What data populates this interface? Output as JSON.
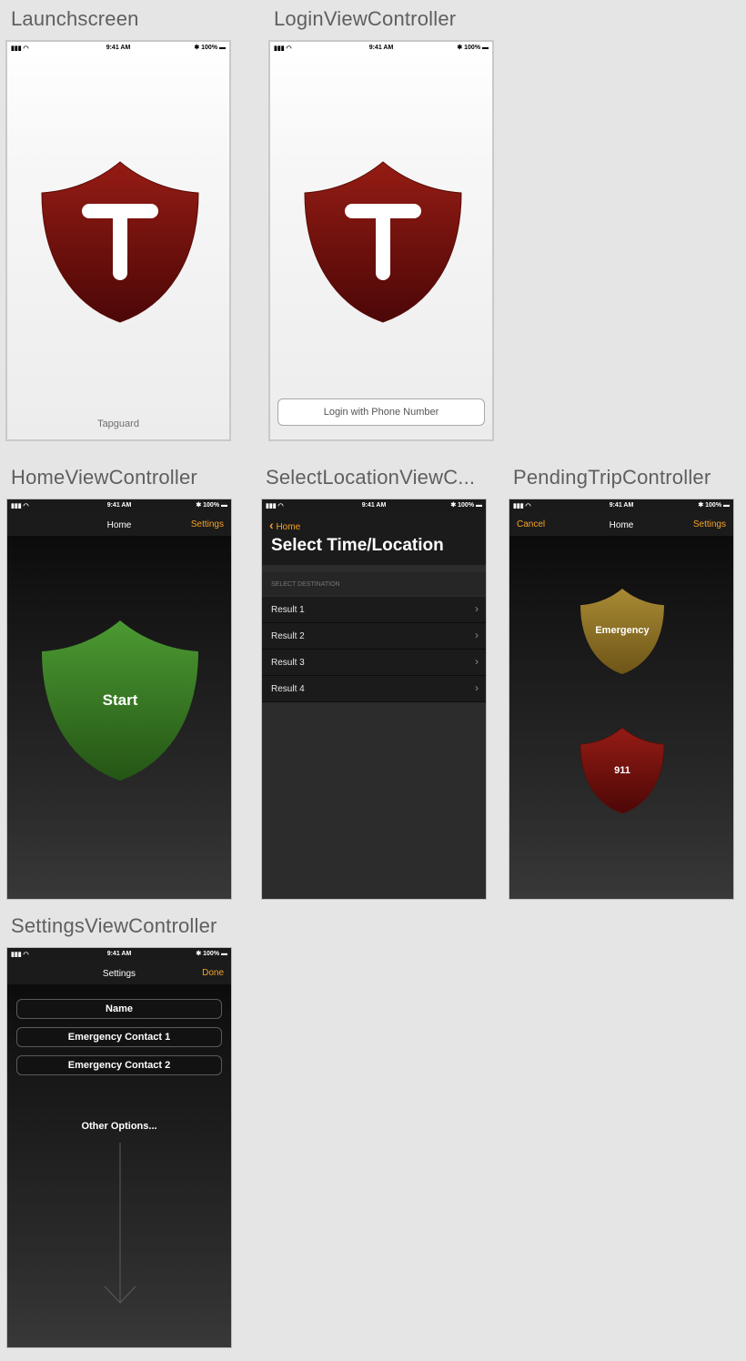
{
  "screens": {
    "launch": {
      "title": "Launchscreen",
      "footer": "Tapguard"
    },
    "login": {
      "title": "LoginViewController",
      "button": "Login with Phone Number"
    },
    "home": {
      "title": "HomeViewController",
      "nav_title": "Home",
      "nav_right": "Settings",
      "start_label": "Start"
    },
    "select": {
      "title": "SelectLocationViewC...",
      "back_label": "Home",
      "large_title": "Select Time/Location",
      "section_header": "SELECT DESTINATION",
      "results": [
        "Result 1",
        "Result 2",
        "Result 3",
        "Result 4"
      ]
    },
    "pending": {
      "title": "PendingTripController",
      "nav_left": "Cancel",
      "nav_title": "Home",
      "nav_right": "Settings",
      "emergency_label": "Emergency",
      "call_label": "911"
    },
    "settings": {
      "title": "SettingsViewController",
      "nav_title": "Settings",
      "nav_right": "Done",
      "fields": [
        "Name",
        "Emergency Contact 1",
        "Emergency Contact 2"
      ],
      "other_options": "Other Options..."
    }
  },
  "statusbar": {
    "time": "9:41 AM",
    "battery": "100%"
  },
  "colors": {
    "accent": "#f7a326",
    "shield_red": "#8c1a14",
    "shield_green": "#3f8b2a",
    "shield_gold": "#9a7d2b"
  },
  "icons": [
    "signal-wifi-icon",
    "bluetooth-icon",
    "battery-icon",
    "chevron-left-icon",
    "chevron-right-icon",
    "shield-icon",
    "arrow-down-icon"
  ]
}
